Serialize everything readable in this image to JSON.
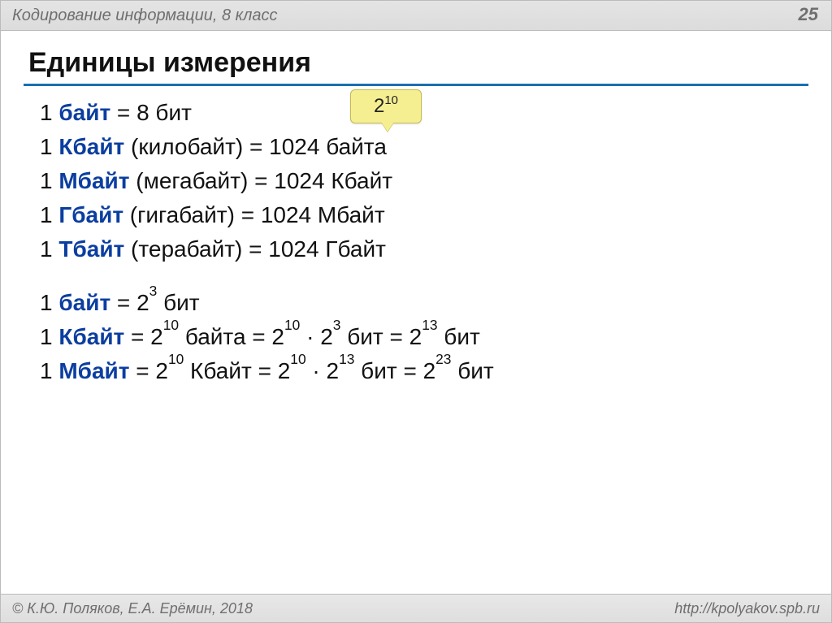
{
  "header": {
    "subject": "Кодирование информации, 8 класс",
    "page": "25"
  },
  "title": "Единицы измерения",
  "callout": {
    "base": "2",
    "exp": "10"
  },
  "block1": [
    {
      "lead": "1 ",
      "unit": "байт",
      "rest": " = 8 бит"
    },
    {
      "lead": "1 ",
      "unit": "Кбайт",
      "rest": " (килобайт) = 1024 байта"
    },
    {
      "lead": "1 ",
      "unit": "Мбайт",
      "rest": " (мегабайт) = 1024 Кбайт"
    },
    {
      "lead": "1 ",
      "unit": "Гбайт",
      "rest": " (гигабайт) = 1024 Мбайт"
    },
    {
      "lead": "1 ",
      "unit": "Тбайт",
      "rest": " (терабайт) = 1024 Гбайт"
    }
  ],
  "block2": [
    {
      "lead": "1 ",
      "unit": "байт",
      "seg1": " = 2",
      "e1": "3",
      "seg2": " бит"
    },
    {
      "lead": "1 ",
      "unit": "Кбайт",
      "seg1": " = 2",
      "e1": "10",
      "seg2": " байта = 2",
      "e2": "10",
      "seg3": " · 2",
      "e3": "3",
      "seg4": " бит = 2",
      "e4": "13",
      "seg5": " бит"
    },
    {
      "lead": "1 ",
      "unit": "Мбайт",
      "seg1": " = 2",
      "e1": "10",
      "seg2": " Кбайт = 2",
      "e2": "10",
      "seg3": " · 2",
      "e3": "13",
      "seg4": "  бит = 2",
      "e4": "23",
      "seg5": " бит"
    }
  ],
  "footer": {
    "left": "© К.Ю. Поляков, Е.А. Ерёмин, 2018",
    "right": "http://kpolyakov.spb.ru"
  }
}
